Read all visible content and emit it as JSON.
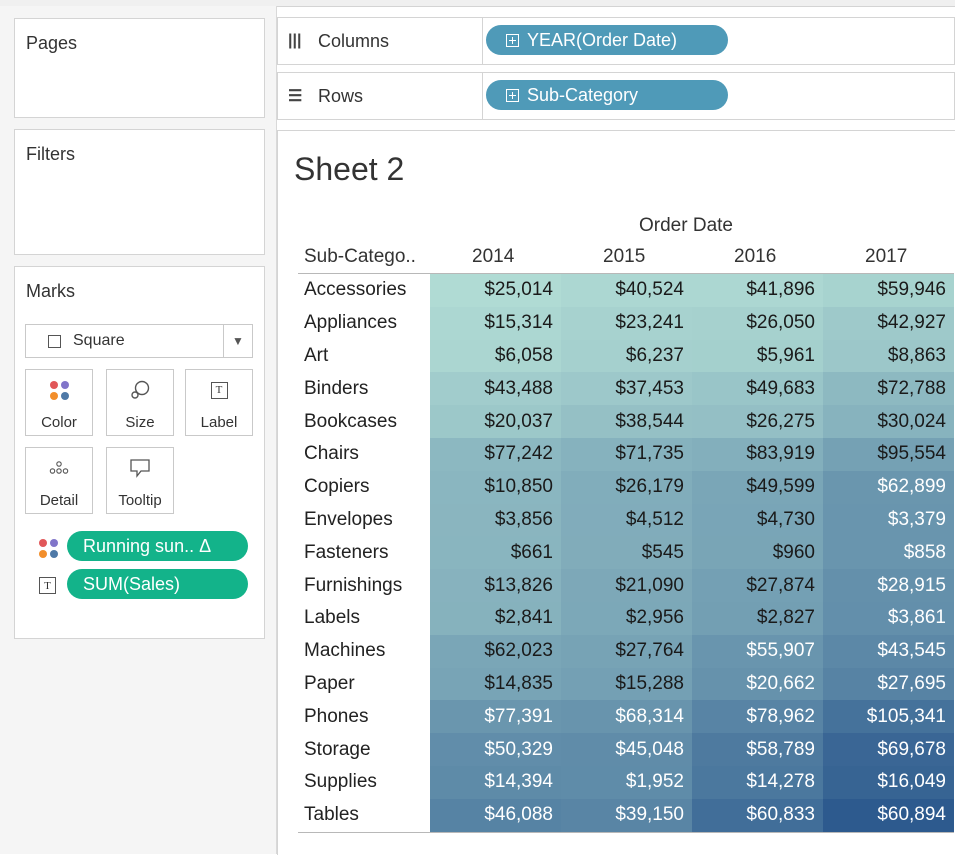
{
  "cards": {
    "pages": "Pages",
    "filters": "Filters",
    "marks": "Marks"
  },
  "marks": {
    "type": "Square",
    "buttons": {
      "color": "Color",
      "size": "Size",
      "label": "Label",
      "detail": "Detail",
      "tooltip": "Tooltip"
    },
    "fields": {
      "color_field": "Running sun.. Δ",
      "label_field": "SUM(Sales)"
    }
  },
  "shelves": {
    "columns_label": "Columns",
    "columns_pill": "YEAR(Order Date)",
    "rows_label": "Rows",
    "rows_pill": "Sub-Category"
  },
  "colors": {
    "pill_blue": "#4f9ab8",
    "pill_green": "#13b38a",
    "heat_low": "#b8e3d8",
    "heat_high": "#2d5a8e"
  },
  "sheet": {
    "title": "Sheet 2",
    "column_group_title": "Order Date",
    "row_header": "Sub-Catego..",
    "years": [
      "2014",
      "2015",
      "2016",
      "2017"
    ],
    "rows": [
      {
        "category": "Accessories",
        "values": [
          "$25,014",
          "$40,524",
          "$41,896",
          "$59,946"
        ]
      },
      {
        "category": "Appliances",
        "values": [
          "$15,314",
          "$23,241",
          "$26,050",
          "$42,927"
        ]
      },
      {
        "category": "Art",
        "values": [
          "$6,058",
          "$6,237",
          "$5,961",
          "$8,863"
        ]
      },
      {
        "category": "Binders",
        "values": [
          "$43,488",
          "$37,453",
          "$49,683",
          "$72,788"
        ]
      },
      {
        "category": "Bookcases",
        "values": [
          "$20,037",
          "$38,544",
          "$26,275",
          "$30,024"
        ]
      },
      {
        "category": "Chairs",
        "values": [
          "$77,242",
          "$71,735",
          "$83,919",
          "$95,554"
        ]
      },
      {
        "category": "Copiers",
        "values": [
          "$10,850",
          "$26,179",
          "$49,599",
          "$62,899"
        ]
      },
      {
        "category": "Envelopes",
        "values": [
          "$3,856",
          "$4,512",
          "$4,730",
          "$3,379"
        ]
      },
      {
        "category": "Fasteners",
        "values": [
          "$661",
          "$545",
          "$960",
          "$858"
        ]
      },
      {
        "category": "Furnishings",
        "values": [
          "$13,826",
          "$21,090",
          "$27,874",
          "$28,915"
        ]
      },
      {
        "category": "Labels",
        "values": [
          "$2,841",
          "$2,956",
          "$2,827",
          "$3,861"
        ]
      },
      {
        "category": "Machines",
        "values": [
          "$62,023",
          "$27,764",
          "$55,907",
          "$43,545"
        ]
      },
      {
        "category": "Paper",
        "values": [
          "$14,835",
          "$15,288",
          "$20,662",
          "$27,695"
        ]
      },
      {
        "category": "Phones",
        "values": [
          "$77,391",
          "$68,314",
          "$78,962",
          "$105,341"
        ]
      },
      {
        "category": "Storage",
        "values": [
          "$50,329",
          "$45,048",
          "$58,789",
          "$69,678"
        ]
      },
      {
        "category": "Supplies",
        "values": [
          "$14,394",
          "$1,952",
          "$14,278",
          "$16,049"
        ]
      },
      {
        "category": "Tables",
        "values": [
          "$46,088",
          "$39,150",
          "$60,833",
          "$60,894"
        ]
      }
    ]
  }
}
